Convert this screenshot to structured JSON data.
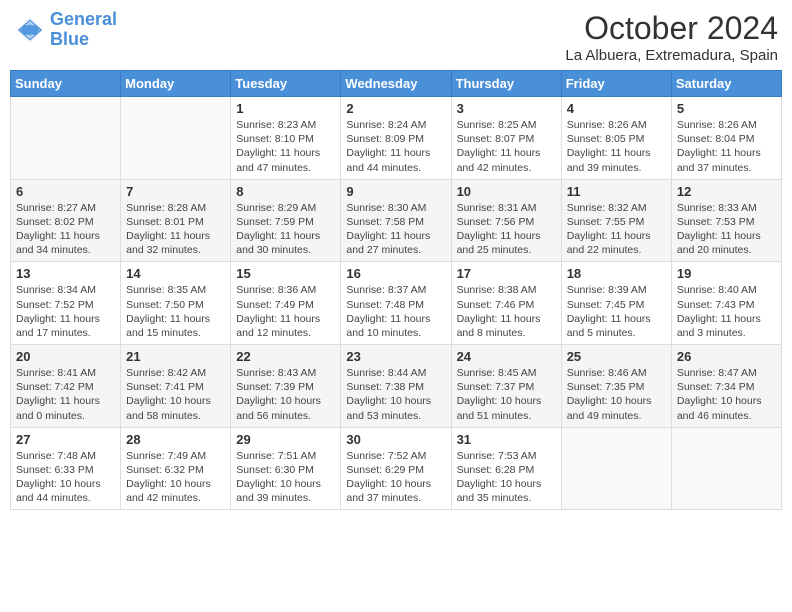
{
  "header": {
    "logo_line1": "General",
    "logo_line2": "Blue",
    "month": "October 2024",
    "location": "La Albuera, Extremadura, Spain"
  },
  "days_of_week": [
    "Sunday",
    "Monday",
    "Tuesday",
    "Wednesday",
    "Thursday",
    "Friday",
    "Saturday"
  ],
  "weeks": [
    [
      {
        "day": "",
        "info": ""
      },
      {
        "day": "",
        "info": ""
      },
      {
        "day": "1",
        "info": "Sunrise: 8:23 AM\nSunset: 8:10 PM\nDaylight: 11 hours and 47 minutes."
      },
      {
        "day": "2",
        "info": "Sunrise: 8:24 AM\nSunset: 8:09 PM\nDaylight: 11 hours and 44 minutes."
      },
      {
        "day": "3",
        "info": "Sunrise: 8:25 AM\nSunset: 8:07 PM\nDaylight: 11 hours and 42 minutes."
      },
      {
        "day": "4",
        "info": "Sunrise: 8:26 AM\nSunset: 8:05 PM\nDaylight: 11 hours and 39 minutes."
      },
      {
        "day": "5",
        "info": "Sunrise: 8:26 AM\nSunset: 8:04 PM\nDaylight: 11 hours and 37 minutes."
      }
    ],
    [
      {
        "day": "6",
        "info": "Sunrise: 8:27 AM\nSunset: 8:02 PM\nDaylight: 11 hours and 34 minutes."
      },
      {
        "day": "7",
        "info": "Sunrise: 8:28 AM\nSunset: 8:01 PM\nDaylight: 11 hours and 32 minutes."
      },
      {
        "day": "8",
        "info": "Sunrise: 8:29 AM\nSunset: 7:59 PM\nDaylight: 11 hours and 30 minutes."
      },
      {
        "day": "9",
        "info": "Sunrise: 8:30 AM\nSunset: 7:58 PM\nDaylight: 11 hours and 27 minutes."
      },
      {
        "day": "10",
        "info": "Sunrise: 8:31 AM\nSunset: 7:56 PM\nDaylight: 11 hours and 25 minutes."
      },
      {
        "day": "11",
        "info": "Sunrise: 8:32 AM\nSunset: 7:55 PM\nDaylight: 11 hours and 22 minutes."
      },
      {
        "day": "12",
        "info": "Sunrise: 8:33 AM\nSunset: 7:53 PM\nDaylight: 11 hours and 20 minutes."
      }
    ],
    [
      {
        "day": "13",
        "info": "Sunrise: 8:34 AM\nSunset: 7:52 PM\nDaylight: 11 hours and 17 minutes."
      },
      {
        "day": "14",
        "info": "Sunrise: 8:35 AM\nSunset: 7:50 PM\nDaylight: 11 hours and 15 minutes."
      },
      {
        "day": "15",
        "info": "Sunrise: 8:36 AM\nSunset: 7:49 PM\nDaylight: 11 hours and 12 minutes."
      },
      {
        "day": "16",
        "info": "Sunrise: 8:37 AM\nSunset: 7:48 PM\nDaylight: 11 hours and 10 minutes."
      },
      {
        "day": "17",
        "info": "Sunrise: 8:38 AM\nSunset: 7:46 PM\nDaylight: 11 hours and 8 minutes."
      },
      {
        "day": "18",
        "info": "Sunrise: 8:39 AM\nSunset: 7:45 PM\nDaylight: 11 hours and 5 minutes."
      },
      {
        "day": "19",
        "info": "Sunrise: 8:40 AM\nSunset: 7:43 PM\nDaylight: 11 hours and 3 minutes."
      }
    ],
    [
      {
        "day": "20",
        "info": "Sunrise: 8:41 AM\nSunset: 7:42 PM\nDaylight: 11 hours and 0 minutes."
      },
      {
        "day": "21",
        "info": "Sunrise: 8:42 AM\nSunset: 7:41 PM\nDaylight: 10 hours and 58 minutes."
      },
      {
        "day": "22",
        "info": "Sunrise: 8:43 AM\nSunset: 7:39 PM\nDaylight: 10 hours and 56 minutes."
      },
      {
        "day": "23",
        "info": "Sunrise: 8:44 AM\nSunset: 7:38 PM\nDaylight: 10 hours and 53 minutes."
      },
      {
        "day": "24",
        "info": "Sunrise: 8:45 AM\nSunset: 7:37 PM\nDaylight: 10 hours and 51 minutes."
      },
      {
        "day": "25",
        "info": "Sunrise: 8:46 AM\nSunset: 7:35 PM\nDaylight: 10 hours and 49 minutes."
      },
      {
        "day": "26",
        "info": "Sunrise: 8:47 AM\nSunset: 7:34 PM\nDaylight: 10 hours and 46 minutes."
      }
    ],
    [
      {
        "day": "27",
        "info": "Sunrise: 7:48 AM\nSunset: 6:33 PM\nDaylight: 10 hours and 44 minutes."
      },
      {
        "day": "28",
        "info": "Sunrise: 7:49 AM\nSunset: 6:32 PM\nDaylight: 10 hours and 42 minutes."
      },
      {
        "day": "29",
        "info": "Sunrise: 7:51 AM\nSunset: 6:30 PM\nDaylight: 10 hours and 39 minutes."
      },
      {
        "day": "30",
        "info": "Sunrise: 7:52 AM\nSunset: 6:29 PM\nDaylight: 10 hours and 37 minutes."
      },
      {
        "day": "31",
        "info": "Sunrise: 7:53 AM\nSunset: 6:28 PM\nDaylight: 10 hours and 35 minutes."
      },
      {
        "day": "",
        "info": ""
      },
      {
        "day": "",
        "info": ""
      }
    ]
  ]
}
